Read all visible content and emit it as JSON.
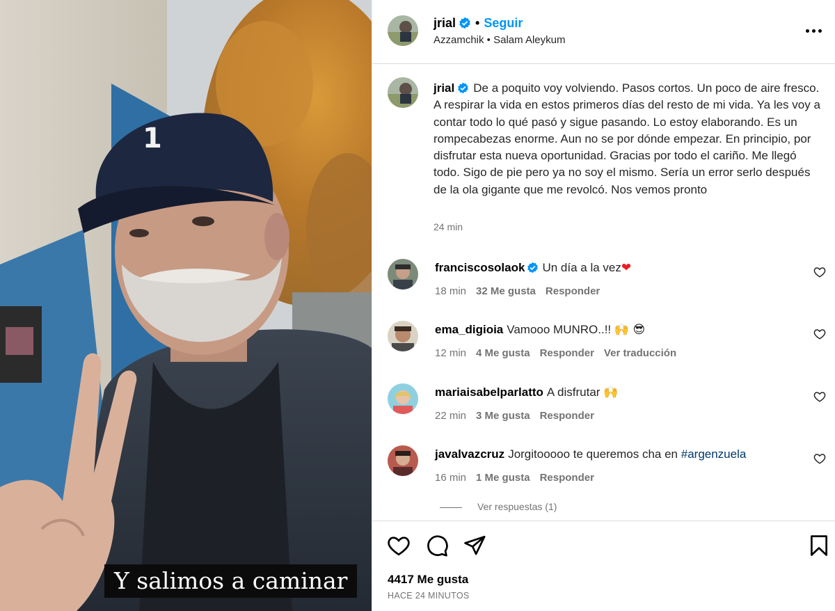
{
  "header": {
    "username": "jrial",
    "follow_label": "Seguir",
    "music": "Azzamchik • Salam Aleykum"
  },
  "post": {
    "username": "jrial",
    "caption": "De a poquito voy volviendo. Pasos cortos. Un poco de aire fresco. A respirar la vida en estos primeros días del resto de mi vida. Ya les voy a contar todo lo qué pasó y sigue pasando. Lo estoy elaborando. Es un rompecabezas enorme. Aun no se por dónde empezar. En principio, por disfrutar esta nueva oportunidad. Gracias por todo el cariño. Me llegó todo. Sigo de pie pero ya no soy el mismo. Sería un error serlo después de la ola gigante que me revolcó. Nos vemos pronto",
    "time": "24 min"
  },
  "video": {
    "subtitle": "Y salimos a caminar"
  },
  "comments": [
    {
      "username": "franciscosolaok",
      "text": "Un día a la vez",
      "emoji": "❤",
      "time": "18 min",
      "likes": "32 Me gusta",
      "reply": "Responder",
      "translate": ""
    },
    {
      "username": "ema_digioia",
      "text": "Vamooo MUNRO..!!",
      "emoji": "🙌 😎",
      "time": "12 min",
      "likes": "4 Me gusta",
      "reply": "Responder",
      "translate": "Ver traducción"
    },
    {
      "username": "mariaisabelparlatto",
      "text": "A disfrutar",
      "emoji": "🙌",
      "time": "22 min",
      "likes": "3 Me gusta",
      "reply": "Responder",
      "translate": ""
    },
    {
      "username": "javalvazcruz",
      "text": "Jorgitooooo te queremos cha en",
      "hashtag": "#argenzuela",
      "time": "16 min",
      "likes": "1 Me gusta",
      "reply": "Responder",
      "translate": ""
    }
  ],
  "view_replies": "Ver respuestas (1)",
  "footer": {
    "likes": "4417 Me gusta",
    "posted": "HACE 24 MINUTOS"
  },
  "colors": {
    "link": "#0095f6",
    "secondary_text": "#737373",
    "hashtag": "#00376b",
    "verified": "#0095f6"
  }
}
